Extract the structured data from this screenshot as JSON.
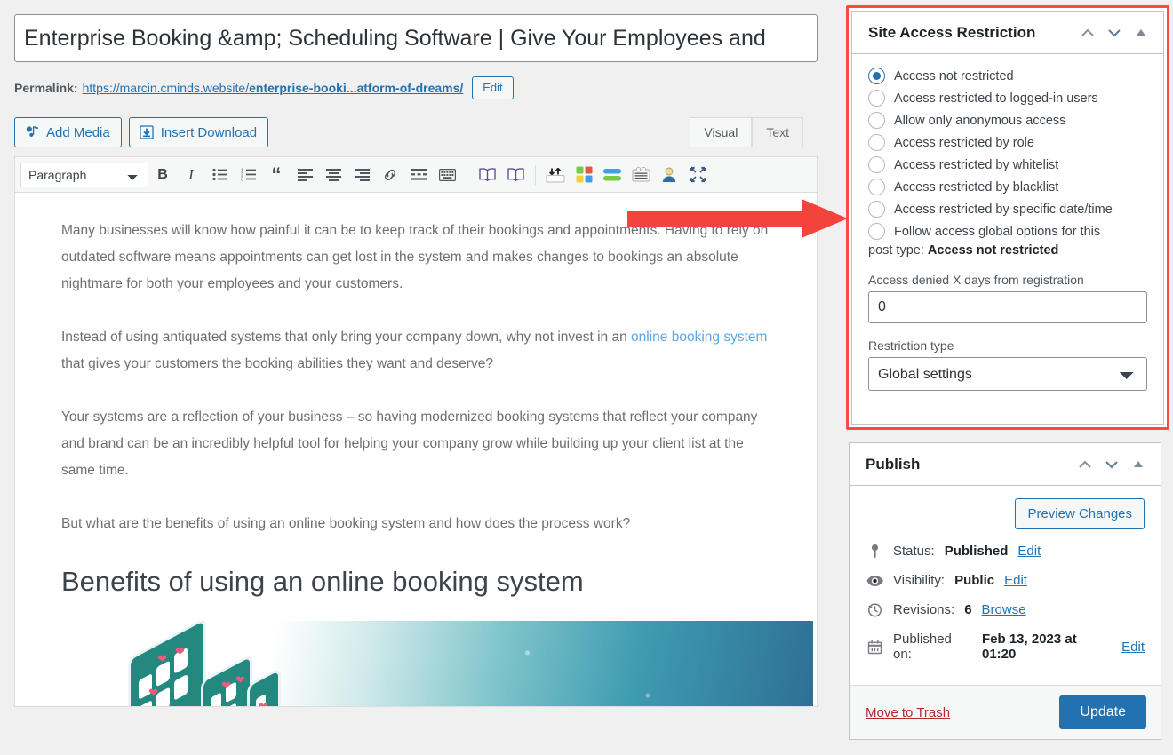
{
  "editor": {
    "post_title": "Enterprise Booking &amp; Scheduling Software | Give Your Employees and",
    "permalink_label": "Permalink:",
    "permalink_base": "https://marcin.cminds.website/",
    "permalink_slug": "enterprise-booki...atform-of-dreams/",
    "permalink_edit_label": "Edit",
    "add_media_label": "Add Media",
    "insert_download_label": "Insert Download",
    "tabs": [
      {
        "label": "Visual",
        "active": true
      },
      {
        "label": "Text",
        "active": false
      }
    ],
    "format_select_value": "Paragraph",
    "toolbar_icons": [
      "bold-icon",
      "italic-icon",
      "bulleted-list-icon",
      "numbered-list-icon",
      "blockquote-icon",
      "align-left-icon",
      "align-center-icon",
      "align-right-icon",
      "link-icon",
      "read-more-icon",
      "keyboard-shortcuts-icon",
      "book-icon",
      "book-open-icon",
      "import-export-icon",
      "blocks-icon",
      "buttons-icon",
      "table-icon",
      "user-icon",
      "fullscreen-icon"
    ],
    "content": {
      "paragraph_1": "Many businesses will know how painful it can be to keep track of their bookings and appointments. Having to rely on outdated software means appointments can get lost in the system and makes changes to bookings an absolute nightmare for both your employees and your customers.",
      "paragraph_2_before_link": "Instead of using antiquated systems that only bring your company down, why not invest in an ",
      "paragraph_2_link": "online booking system",
      "paragraph_2_after_link": " that gives your customers the booking abilities they want and deserve?",
      "paragraph_3": "Your systems are a reflection of your business – so having modernized booking systems that reflect your company and brand can be an incredibly helpful tool for helping your company grow while building up your client list at the same time.",
      "paragraph_4": "But what are the benefits of using an online booking system and how does the process work?",
      "heading_1": "Benefits of using an online booking system"
    }
  },
  "annotation": {
    "arrow_color": "#f4433c",
    "highlight_color": "#fb4a41"
  },
  "restriction_panel": {
    "title": "Site Access Restriction",
    "options": [
      {
        "label": "Access not restricted",
        "selected": true
      },
      {
        "label": "Access restricted to logged-in users",
        "selected": false
      },
      {
        "label": "Allow only anonymous access",
        "selected": false
      },
      {
        "label": "Access restricted by role",
        "selected": false
      },
      {
        "label": "Access restricted by whitelist",
        "selected": false
      },
      {
        "label": "Access restricted by blacklist",
        "selected": false
      },
      {
        "label": "Access restricted by specific date/time",
        "selected": false
      },
      {
        "label": "Follow access global options for this",
        "selected": false
      }
    ],
    "follow_note_prefix": "post type: ",
    "follow_note_value": "Access not restricted",
    "days_label": "Access denied X days from registration",
    "days_value": "0",
    "restriction_type_label": "Restriction type",
    "restriction_type_value": "Global settings"
  },
  "publish_panel": {
    "title": "Publish",
    "preview_label": "Preview Changes",
    "status_label": "Status: ",
    "status_value": "Published",
    "status_edit": "Edit",
    "visibility_label": "Visibility: ",
    "visibility_value": "Public",
    "visibility_edit": "Edit",
    "revisions_label": "Revisions: ",
    "revisions_count": "6",
    "revisions_browse": "Browse",
    "published_label": "Published on: ",
    "published_value": "Feb 13, 2023 at 01:20",
    "published_edit": "Edit",
    "trash_label": "Move to Trash",
    "update_label": "Update"
  }
}
